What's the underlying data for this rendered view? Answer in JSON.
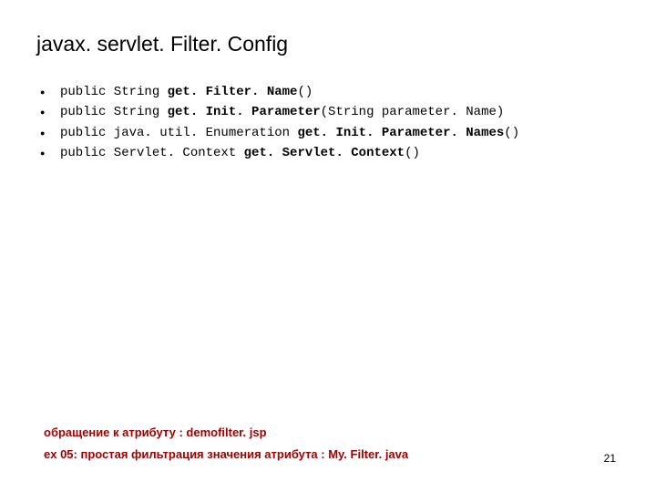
{
  "title": "javax. servlet. Filter. Config",
  "bullets": [
    {
      "prefix": "public String ",
      "bold": "get. Filter. Name",
      "suffix": "()"
    },
    {
      "prefix": "public String ",
      "bold": "get. Init. Parameter",
      "suffix": "(String parameter. Name)"
    },
    {
      "prefix": "public java. util. Enumeration ",
      "bold": "get. Init. Parameter. Names",
      "suffix": "()"
    },
    {
      "prefix": "public Servlet. Context ",
      "bold": "get. Servlet. Context",
      "suffix": "()"
    }
  ],
  "footer": {
    "line1": "обращение к атрибуту : demofilter. jsp",
    "line2": "ex 05: простая фильтрация значения атрибута : My. Filter. java"
  },
  "page_number": "21"
}
